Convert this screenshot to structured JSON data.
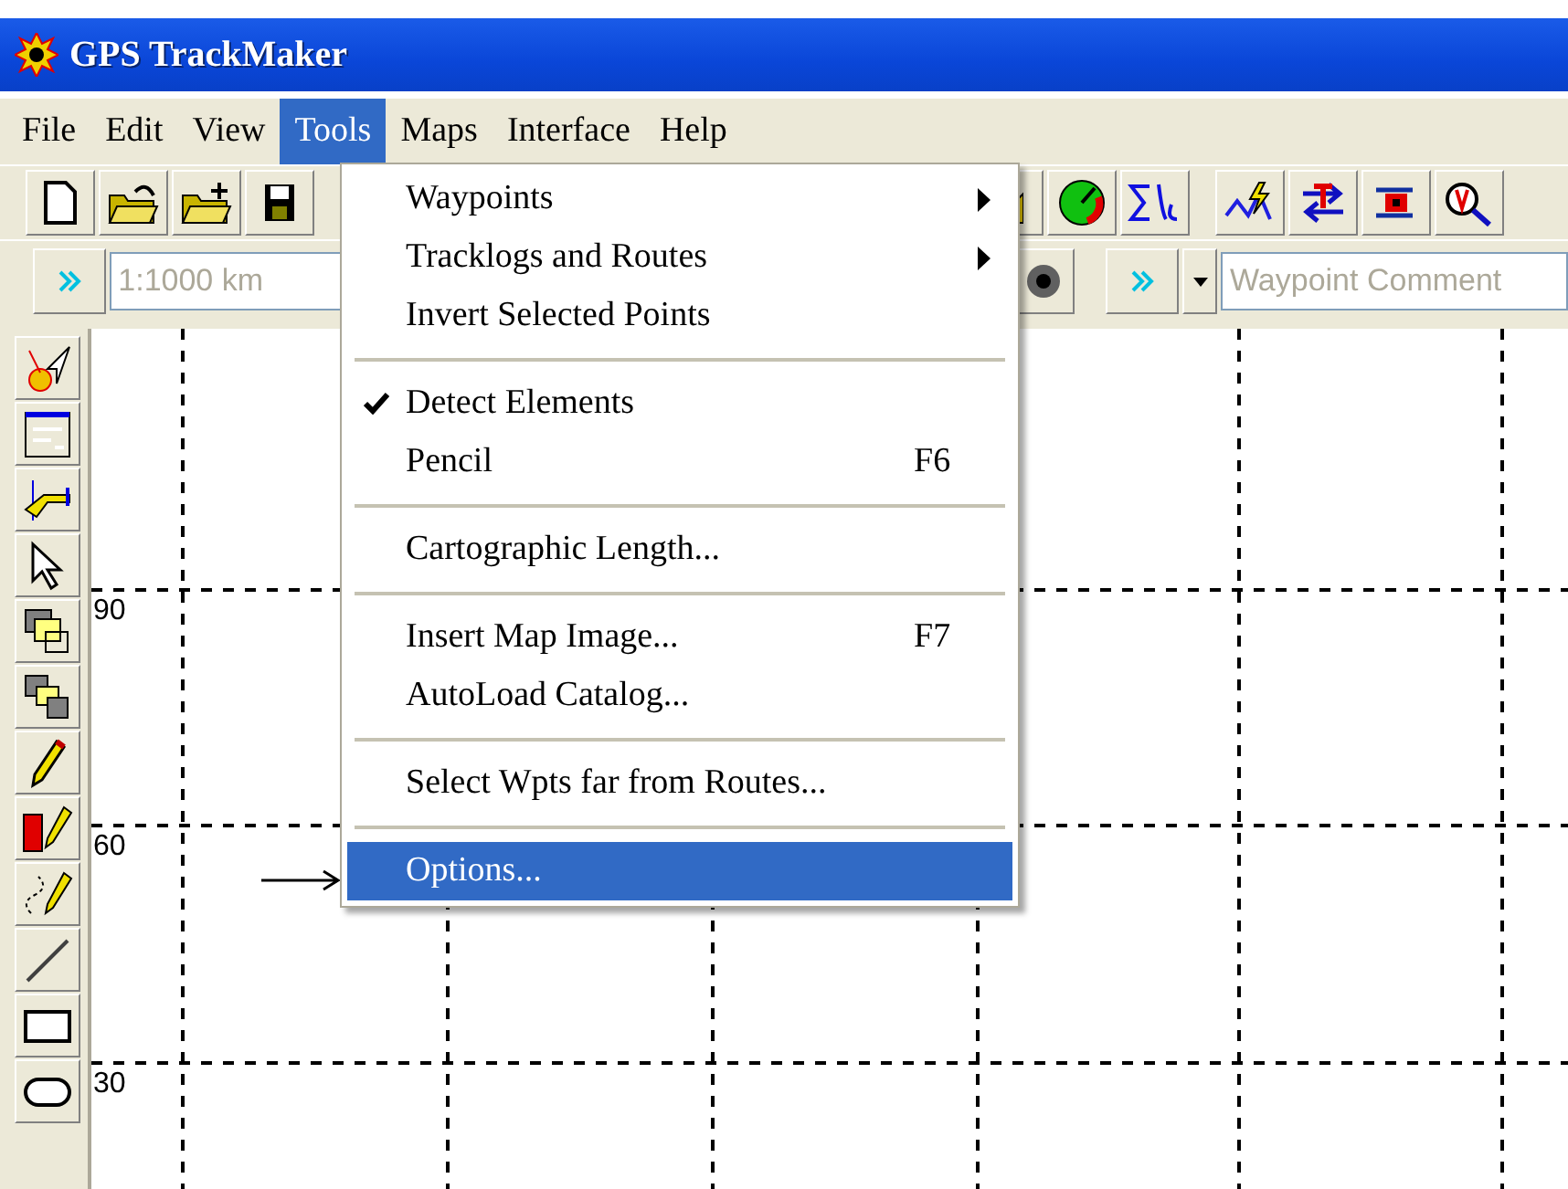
{
  "window": {
    "title": "GPS TrackMaker"
  },
  "menubar": [
    {
      "label": "File",
      "selected": false
    },
    {
      "label": "Edit",
      "selected": false
    },
    {
      "label": "View",
      "selected": false
    },
    {
      "label": "Tools",
      "selected": true
    },
    {
      "label": "Maps",
      "selected": false
    },
    {
      "label": "Interface",
      "selected": false
    },
    {
      "label": "Help",
      "selected": false
    }
  ],
  "scale_field": {
    "placeholder": "1:1000 km"
  },
  "comment_field": {
    "placeholder": "Waypoint Comment"
  },
  "map": {
    "labels": [
      "90",
      "60",
      "30"
    ]
  },
  "tools_menu": [
    {
      "kind": "item",
      "label": "Waypoints",
      "submenu": true,
      "checked": false,
      "selected": false
    },
    {
      "kind": "item",
      "label": "Tracklogs and Routes",
      "submenu": true,
      "checked": false,
      "selected": false
    },
    {
      "kind": "item",
      "label": "Invert Selected Points",
      "submenu": false,
      "checked": false,
      "selected": false
    },
    {
      "kind": "separator"
    },
    {
      "kind": "item",
      "label": "Detect Elements",
      "submenu": false,
      "checked": true,
      "selected": false
    },
    {
      "kind": "item",
      "label": "Pencil",
      "shortcut": "F6",
      "submenu": false,
      "checked": false,
      "selected": false
    },
    {
      "kind": "separator"
    },
    {
      "kind": "item",
      "label": "Cartographic Length...",
      "submenu": false,
      "checked": false,
      "selected": false
    },
    {
      "kind": "separator"
    },
    {
      "kind": "item",
      "label": "Insert Map Image...",
      "shortcut": "F7",
      "submenu": false,
      "checked": false,
      "selected": false
    },
    {
      "kind": "item",
      "label": "AutoLoad Catalog...",
      "submenu": false,
      "checked": false,
      "selected": false
    },
    {
      "kind": "separator"
    },
    {
      "kind": "item",
      "label": "Select Wpts far from Routes...",
      "submenu": false,
      "checked": false,
      "selected": false
    },
    {
      "kind": "separator"
    },
    {
      "kind": "item",
      "label": "Options...",
      "submenu": false,
      "checked": false,
      "selected": true
    }
  ]
}
